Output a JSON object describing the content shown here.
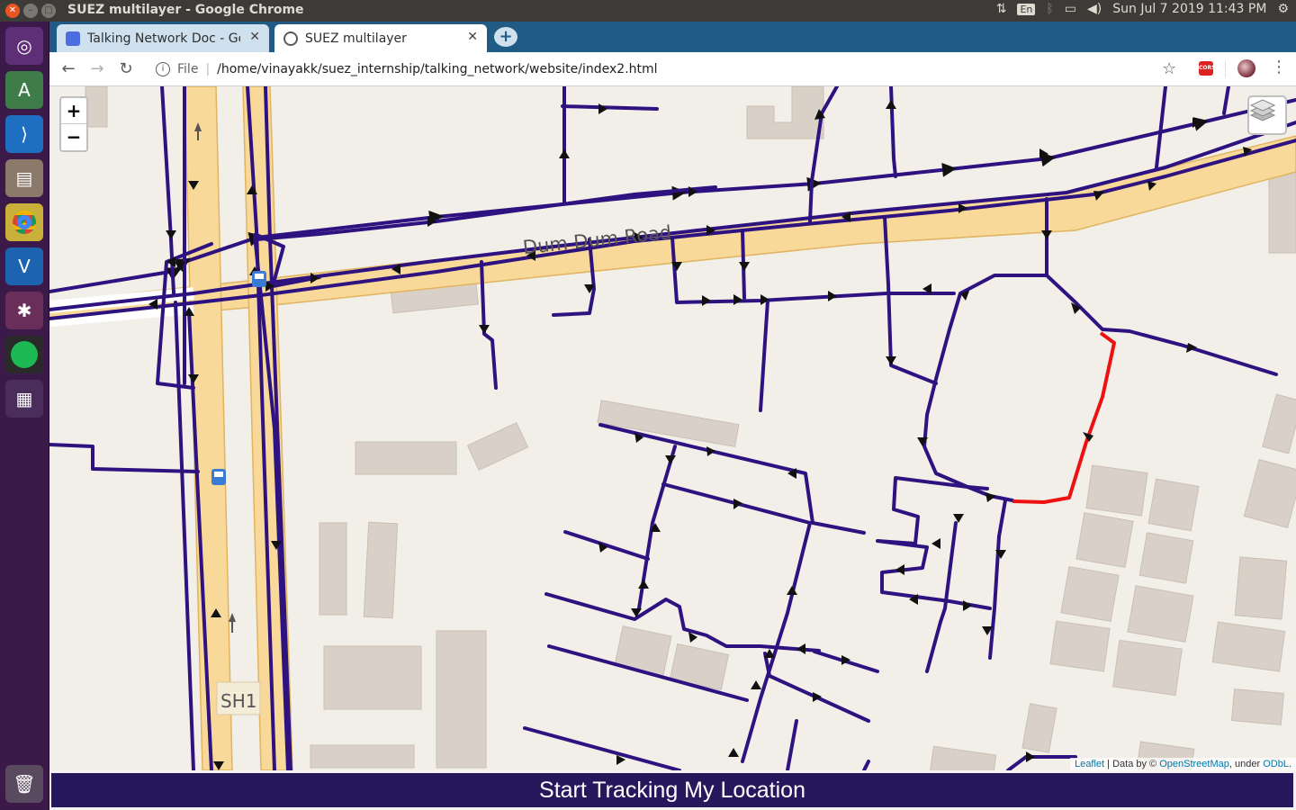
{
  "system": {
    "window_title": "SUEZ multilayer - Google Chrome",
    "keyboard_layout": "En",
    "datetime": "Sun Jul 7 2019 11:43 PM"
  },
  "launcher": {
    "items": [
      {
        "name": "ubuntu-dash-icon"
      },
      {
        "name": "android-studio-icon"
      },
      {
        "name": "vscode-icon"
      },
      {
        "name": "files-icon"
      },
      {
        "name": "chrome-icon"
      },
      {
        "name": "virtualbox-icon"
      },
      {
        "name": "network-tool-icon"
      },
      {
        "name": "spotify-icon"
      },
      {
        "name": "workspace-switcher-icon"
      },
      {
        "name": "trash-icon"
      }
    ]
  },
  "browser": {
    "tabs": [
      {
        "label": "Talking Network Doc - Goo",
        "active": false
      },
      {
        "label": "SUEZ multilayer",
        "active": true
      }
    ],
    "new_tab": "+",
    "url_scheme_label": "File",
    "url": "/home/vinayakk/suez_internship/talking_network/website/index2.html",
    "extension_label": "CORS"
  },
  "map": {
    "road_label": "Dum Dum Road",
    "highway_shield": "SH1",
    "zoom_in": "+",
    "zoom_out": "−",
    "colors": {
      "background": "#f2efe9",
      "major_road": "#f9d99a",
      "buildings": "#d9d0c7",
      "network": "#2e1280",
      "highlight": "#ee1111"
    },
    "attribution": {
      "leaflet": "Leaflet",
      "data_by": " | Data by © ",
      "osm": "OpenStreetMap",
      "under": ", under ",
      "odbl": "ODbL",
      "end": "."
    }
  },
  "track_button": "Start Tracking My Location"
}
